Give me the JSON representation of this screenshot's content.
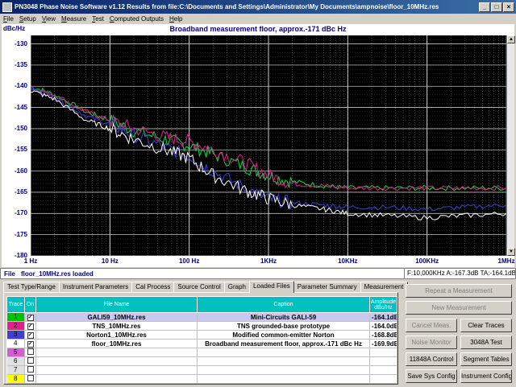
{
  "window": {
    "title": "PN3048 Phase Noise Software v1.12    Results from file:C:\\Documents and Settings\\Administrator\\My Documents\\ampnoise\\floor_10MHz.res"
  },
  "menu": [
    "File",
    "Setup",
    "View",
    "Measure",
    "Test",
    "Computed Outputs",
    "Help"
  ],
  "plot": {
    "title": "Broadband measurement floor, approx.-171 dBc Hz",
    "y_unit": "dBc/Hz",
    "y_ticks": [
      "-130",
      "-135",
      "-140",
      "-145",
      "-150",
      "-155",
      "-160",
      "-165",
      "-170",
      "-175",
      "-180"
    ],
    "x_ticks": [
      "1 Hz",
      "10 Hz",
      "100 Hz",
      "1KHz",
      "10KHz",
      "100KHz",
      "1MHz"
    ]
  },
  "chart_data": {
    "type": "line",
    "title": "Broadband measurement floor, approx.-171 dBc Hz",
    "xlabel": "",
    "ylabel": "dBc/Hz",
    "x_scale": "log",
    "xlim": [
      1,
      1000000
    ],
    "ylim": [
      -180,
      -128
    ],
    "grid": true,
    "series": [
      {
        "name": "Mini-Circuits GALI-59",
        "color": "#00e040",
        "x": [
          1,
          2,
          5,
          10,
          20,
          50,
          100,
          200,
          500,
          1000,
          2000,
          5000,
          10000,
          30000,
          100000,
          300000,
          1000000
        ],
        "y": [
          -140,
          -142,
          -146,
          -148,
          -150.5,
          -152.5,
          -154,
          -156,
          -159,
          -161,
          -162.5,
          -163.5,
          -164,
          -164,
          -164,
          -164,
          -164
        ]
      },
      {
        "name": "TNS grounded-base prototype",
        "color": "#e0208c",
        "x": [
          1,
          2,
          5,
          10,
          20,
          50,
          100,
          200,
          500,
          1000,
          2000,
          5000,
          10000,
          30000,
          100000,
          300000,
          1000000
        ],
        "y": [
          -140.5,
          -142,
          -146,
          -148,
          -150,
          -152,
          -153,
          -155,
          -158,
          -161,
          -163,
          -163.5,
          -164,
          -164,
          -164,
          -164,
          -164
        ]
      },
      {
        "name": "Modified common-emitter Norton",
        "color": "#4040d0",
        "x": [
          1,
          2,
          5,
          10,
          20,
          50,
          100,
          200,
          500,
          1000,
          2000,
          5000,
          10000,
          30000,
          100000,
          300000,
          1000000
        ],
        "y": [
          -140.5,
          -142.5,
          -147,
          -149,
          -151.5,
          -154.5,
          -156.5,
          -160,
          -164,
          -166.5,
          -167.5,
          -168,
          -168.5,
          -168.5,
          -169,
          -168.5,
          -168
        ]
      },
      {
        "name": "Broadband measurement floor, approx.-171 dBc Hz",
        "color": "#ffffff",
        "x": [
          1,
          2,
          5,
          10,
          20,
          50,
          100,
          200,
          500,
          1000,
          2000,
          5000,
          10000,
          30000,
          100000,
          300000,
          1000000
        ],
        "y": [
          -141,
          -143,
          -148,
          -150,
          -152.5,
          -155,
          -157,
          -161,
          -164.5,
          -166.5,
          -168,
          -169,
          -170,
          -170.5,
          -171,
          -170.5,
          -170
        ]
      }
    ]
  },
  "status": {
    "file_label": "File",
    "file_text": "floor_10MHz.res loaded",
    "cursor": "F:10,000KHz   A:-167.3dB  TA:-164.1dB"
  },
  "tabs": [
    "Test Type/Range",
    "Instrument Parameters",
    "Cal Process",
    "Source Control",
    "Graph",
    "Loaded Files",
    "Parameter Summary",
    "Measurement"
  ],
  "table": {
    "headers": {
      "trace": "Trace",
      "on": "On",
      "file": "File Name",
      "caption": "Caption",
      "amp": "Amplitude dBc/Hz"
    },
    "rows": [
      {
        "trace": "1",
        "color": "#00c000",
        "on": "✓",
        "file": "GALI59_10MHz.res",
        "caption": "Mini-Circuits GALI-59",
        "amp": "-164.1dB"
      },
      {
        "trace": "2",
        "color": "#e0208c",
        "on": "✓",
        "file": "TNS_10MHz.res",
        "caption": "TNS grounded-base prototype",
        "amp": "-164.0dB"
      },
      {
        "trace": "3",
        "color": "#4040d0",
        "on": "✓",
        "file": "Norton1_10MHz.res",
        "caption": "Modified common-emitter Norton",
        "amp": "-168.8dB"
      },
      {
        "trace": "4",
        "color": "#ffffff",
        "on": "✓",
        "file": "floor_10MHz.res",
        "caption": "Broadband measurement floor, approx.-171 dBc Hz",
        "amp": "-169.9dB"
      },
      {
        "trace": "5",
        "color": "#d060d0",
        "on": "",
        "file": "",
        "caption": "",
        "amp": ""
      },
      {
        "trace": "6",
        "color": "#e0e0e0",
        "on": "",
        "file": "",
        "caption": "",
        "amp": ""
      },
      {
        "trace": "7",
        "color": "#e0e0e0",
        "on": "",
        "file": "",
        "caption": "",
        "amp": ""
      },
      {
        "trace": "8",
        "color": "#ffff00",
        "on": "",
        "file": "",
        "caption": "",
        "amp": ""
      }
    ]
  },
  "buttons": {
    "repeat": "Repeat a Measurement",
    "new": "New Measurement",
    "cancel": "Cancel Meas.",
    "clear": "Clear Traces",
    "noise": "Noise Monitor",
    "test3048": "3048A Test",
    "control11848": "11848A Control",
    "segment": "Segment Tables",
    "savesys": "Save Sys Config",
    "instr": "Instrument Config"
  }
}
